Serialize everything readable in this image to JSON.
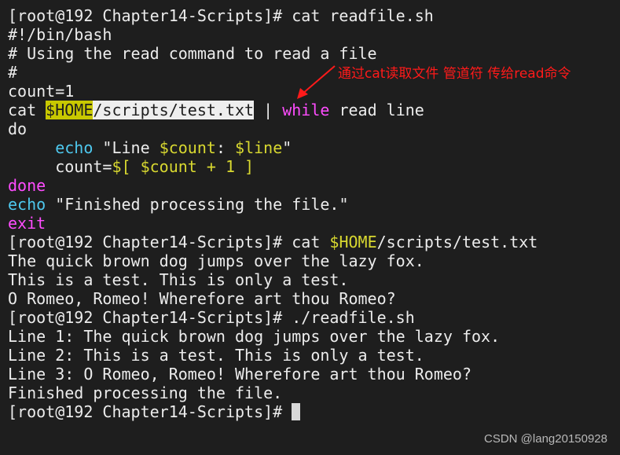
{
  "terminal": {
    "lines": [
      [
        {
          "t": "[root@192 Chapter14-Scripts]# cat readfile.sh",
          "c": "w"
        }
      ],
      [
        {
          "t": "#!/bin/bash",
          "c": "w"
        }
      ],
      [
        {
          "t": "# Using the read command to read a file",
          "c": "w"
        }
      ],
      [
        {
          "t": "#",
          "c": "w"
        }
      ],
      [
        {
          "t": "count=1",
          "c": "w"
        }
      ],
      [
        {
          "t": "cat ",
          "c": "w"
        },
        {
          "t": "$HOME",
          "c": "hy"
        },
        {
          "t": "/scripts/test.txt",
          "c": "hw"
        },
        {
          "t": " | ",
          "c": "w"
        },
        {
          "t": "while",
          "c": "m"
        },
        {
          "t": " read line",
          "c": "w"
        }
      ],
      [
        {
          "t": "do",
          "c": "w"
        }
      ],
      [
        {
          "t": "     ",
          "c": "w"
        },
        {
          "t": "echo",
          "c": "c"
        },
        {
          "t": " \"Line ",
          "c": "w"
        },
        {
          "t": "$count",
          "c": "y"
        },
        {
          "t": ": ",
          "c": "w"
        },
        {
          "t": "$line",
          "c": "y"
        },
        {
          "t": "\"",
          "c": "w"
        }
      ],
      [
        {
          "t": "     count=",
          "c": "w"
        },
        {
          "t": "$[ $count + 1 ]",
          "c": "y"
        }
      ],
      [
        {
          "t": "done",
          "c": "m"
        }
      ],
      [
        {
          "t": "echo",
          "c": "c"
        },
        {
          "t": " \"Finished processing the file.\"",
          "c": "w"
        }
      ],
      [
        {
          "t": "exit",
          "c": "m"
        }
      ],
      [
        {
          "t": "[root@192 Chapter14-Scripts]# cat ",
          "c": "w"
        },
        {
          "t": "$HOME",
          "c": "y"
        },
        {
          "t": "/scripts/test.txt",
          "c": "w"
        }
      ],
      [
        {
          "t": "The quick brown dog jumps over the lazy fox.",
          "c": "w"
        }
      ],
      [
        {
          "t": "This is a test. This is only a test.",
          "c": "w"
        }
      ],
      [
        {
          "t": "O Romeo, Romeo! Wherefore art thou Romeo?",
          "c": "w"
        }
      ],
      [
        {
          "t": "[root@192 Chapter14-Scripts]# ./readfile.sh",
          "c": "w"
        }
      ],
      [
        {
          "t": "Line 1: The quick brown dog jumps over the lazy fox.",
          "c": "w"
        }
      ],
      [
        {
          "t": "Line 2: This is a test. This is only a test.",
          "c": "w"
        }
      ],
      [
        {
          "t": "Line 3: O Romeo, Romeo! Wherefore art thou Romeo?",
          "c": "w"
        }
      ],
      [
        {
          "t": "Finished processing the file.",
          "c": "w"
        }
      ],
      [
        {
          "t": "[root@192 Chapter14-Scripts]# ",
          "c": "w"
        }
      ]
    ]
  },
  "annotation": {
    "text": "通过cat读取文件 管道符 传给read命令",
    "color": "#ff1a1a"
  },
  "watermark": "CSDN @lang20150928"
}
